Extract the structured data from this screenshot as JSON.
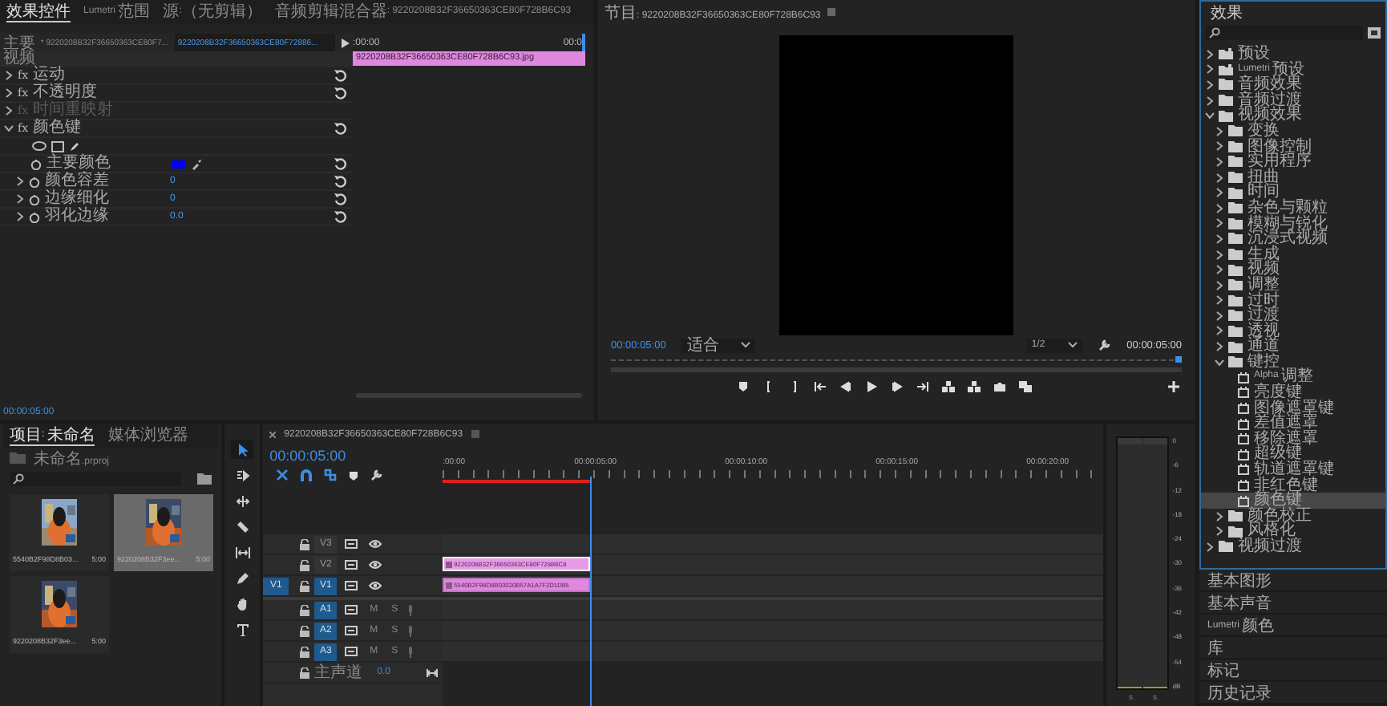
{
  "effect_controls": {
    "tabs": [
      {
        "label": "效果控件",
        "selected": true
      },
      {
        "label": "Lumetri 范围",
        "selected": false
      },
      {
        "label": "源:（无剪辑）",
        "selected": false
      },
      {
        "label": "音频剪辑混合器: 9220208B32F36650363CE80F728B6C93",
        "selected": false
      }
    ],
    "source_clip": "主要 * 9220208B32F36650363CE80F7...",
    "sequence_clip": "9220208B32F36650363CE80F72886...",
    "ruler": [
      ":00:00",
      "00:0"
    ],
    "clip_bar": "9220208B32F36650363CE80F728B6C93.jpg",
    "section": "视频",
    "rows": [
      {
        "kind": "effect",
        "badge": "fx",
        "name": "运动",
        "expanded": false,
        "disabled": false
      },
      {
        "kind": "effect",
        "badge": "fx",
        "name": "不透明度",
        "expanded": false,
        "disabled": false
      },
      {
        "kind": "effect",
        "badge": "fx",
        "name": "时间重映射",
        "expanded": false,
        "disabled": true
      },
      {
        "kind": "effect",
        "badge": "fx",
        "name": "颜色键",
        "expanded": true,
        "disabled": false
      },
      {
        "kind": "masks"
      },
      {
        "kind": "color",
        "name": "主要颜色",
        "color": "#0000ff"
      },
      {
        "kind": "param",
        "name": "颜色容差",
        "value": "0"
      },
      {
        "kind": "param",
        "name": "边缘细化",
        "value": "0"
      },
      {
        "kind": "param",
        "name": "羽化边缘",
        "value": "0.0"
      }
    ],
    "timecode": "00:00:05:00"
  },
  "program": {
    "title": "节目: 9220208B32F36650363CE80F728B6C93",
    "timecode": "00:00:05:00",
    "zoom": "适合",
    "resolution": "1/2",
    "duration": "00:00:05:00"
  },
  "project": {
    "tabs": [
      {
        "label": "项目: 未命名",
        "selected": true
      },
      {
        "label": "媒体浏览器",
        "selected": false
      }
    ],
    "file": "未命名.prproj",
    "items": [
      {
        "name": "5540B2F98D8B03...",
        "duration": "5:00",
        "selected": false
      },
      {
        "name": "9220208B32F3ee...",
        "duration": "5:00",
        "selected": true
      },
      {
        "name": "9220208B32F3ee...",
        "duration": "5:00",
        "selected": false
      }
    ]
  },
  "timeline": {
    "title": "9220208B32F36650363CE80F728B6C93",
    "timecode": "00:00:05:00",
    "ruler": [
      ":00:00",
      "00:00:05:00",
      "00:00:10:00",
      "00:00:15:00",
      "00:00:20:00"
    ],
    "tracks": [
      {
        "kind": "video",
        "name": "V3",
        "targeted": false
      },
      {
        "kind": "video",
        "name": "V2",
        "targeted": false,
        "clip": {
          "name": "9220208B32F36650363CE80F728B6C8",
          "selected": true
        }
      },
      {
        "kind": "video",
        "name": "V1",
        "targeted": true,
        "source": "V1",
        "clip": {
          "name": "5540B2F98D8B03020B57A1A7F2D1D85",
          "selected": false
        }
      },
      {
        "kind": "audio",
        "name": "A1",
        "targeted": true,
        "mute": "M",
        "solo": "S"
      },
      {
        "kind": "audio",
        "name": "A2",
        "targeted": true,
        "mute": "M",
        "solo": "S"
      },
      {
        "kind": "audio",
        "name": "A3",
        "targeted": true,
        "mute": "M",
        "solo": "S"
      }
    ],
    "master": {
      "name": "主声道",
      "value": "0.0"
    }
  },
  "meter": {
    "scale": [
      "0",
      "-6",
      "-12",
      "-18",
      "-24",
      "-30",
      "-36",
      "-42",
      "-48",
      "-54",
      "dB"
    ],
    "channels": [
      "S",
      "S"
    ]
  },
  "effects": {
    "title": "效果",
    "tree": [
      {
        "kind": "preset",
        "name": "预设",
        "expanded": false,
        "selected": false
      },
      {
        "kind": "preset",
        "name": "Lumetri 预设",
        "expanded": false,
        "selected": false
      },
      {
        "kind": "folder",
        "name": "音频效果",
        "expanded": false,
        "selected": false
      },
      {
        "kind": "folder",
        "name": "音频过渡",
        "expanded": false,
        "selected": false
      },
      {
        "kind": "folder",
        "name": "视频效果",
        "expanded": true,
        "selected": false,
        "children": [
          {
            "kind": "folder",
            "name": "变换",
            "expanded": false,
            "selected": false
          },
          {
            "kind": "folder",
            "name": "图像控制",
            "expanded": false,
            "selected": false
          },
          {
            "kind": "folder",
            "name": "实用程序",
            "expanded": false,
            "selected": false
          },
          {
            "kind": "folder",
            "name": "扭曲",
            "expanded": false,
            "selected": false
          },
          {
            "kind": "folder",
            "name": "时间",
            "expanded": false,
            "selected": false
          },
          {
            "kind": "folder",
            "name": "杂色与颗粒",
            "expanded": false,
            "selected": false
          },
          {
            "kind": "folder",
            "name": "模糊与锐化",
            "expanded": false,
            "selected": false
          },
          {
            "kind": "folder",
            "name": "沉浸式视频",
            "expanded": false,
            "selected": false
          },
          {
            "kind": "folder",
            "name": "生成",
            "expanded": false,
            "selected": false
          },
          {
            "kind": "folder",
            "name": "视频",
            "expanded": false,
            "selected": false
          },
          {
            "kind": "folder",
            "name": "调整",
            "expanded": false,
            "selected": false
          },
          {
            "kind": "folder",
            "name": "过时",
            "expanded": false,
            "selected": false
          },
          {
            "kind": "folder",
            "name": "过渡",
            "expanded": false,
            "selected": false
          },
          {
            "kind": "folder",
            "name": "透视",
            "expanded": false,
            "selected": false
          },
          {
            "kind": "folder",
            "name": "通道",
            "expanded": false,
            "selected": false
          },
          {
            "kind": "folder",
            "name": "键控",
            "expanded": true,
            "selected": false,
            "children": [
              {
                "kind": "effect",
                "name": "Alpha 调整",
                "selected": false
              },
              {
                "kind": "effect",
                "name": "亮度键",
                "selected": false
              },
              {
                "kind": "effect",
                "name": "图像遮罩键",
                "selected": false
              },
              {
                "kind": "effect",
                "name": "差值遮罩",
                "selected": false
              },
              {
                "kind": "effect",
                "name": "移除遮罩",
                "selected": false
              },
              {
                "kind": "effect",
                "name": "超级键",
                "selected": false
              },
              {
                "kind": "effect",
                "name": "轨道遮罩键",
                "selected": false
              },
              {
                "kind": "effect",
                "name": "非红色键",
                "selected": false
              },
              {
                "kind": "effect",
                "name": "颜色键",
                "selected": true
              }
            ]
          },
          {
            "kind": "folder",
            "name": "颜色校正",
            "expanded": false,
            "selected": false
          },
          {
            "kind": "folder",
            "name": "风格化",
            "expanded": false,
            "selected": false
          }
        ]
      },
      {
        "kind": "folder",
        "name": "视频过渡",
        "expanded": false,
        "selected": false
      }
    ],
    "panels": [
      "基本图形",
      "基本声音",
      "Lumetri 颜色",
      "库",
      "标记",
      "历史记录"
    ]
  }
}
